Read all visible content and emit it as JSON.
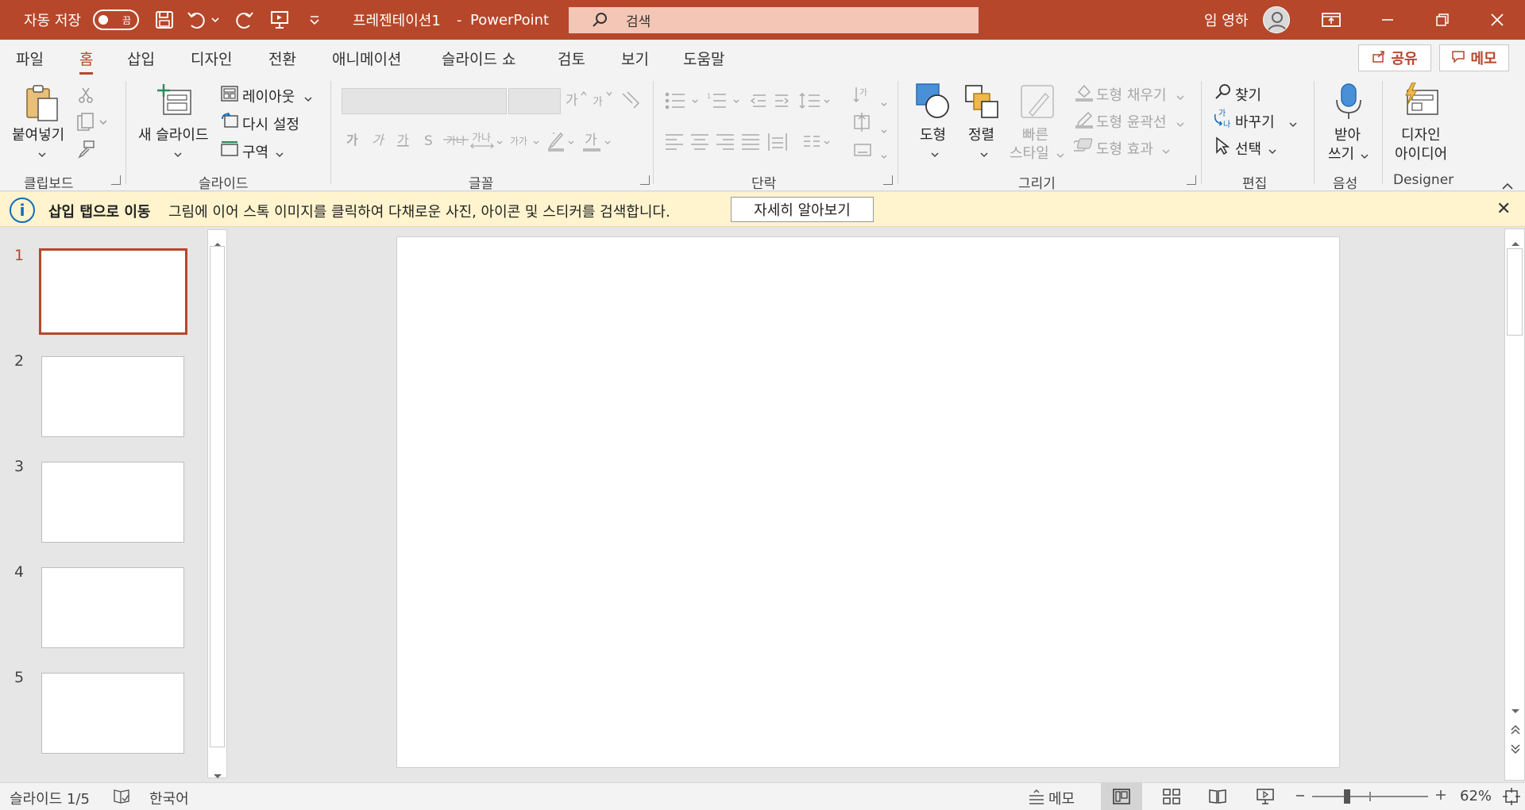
{
  "titlebar": {
    "autosave_label": "자동 저장",
    "autosave_state": "끔",
    "doc_title": "프레젠테이션1",
    "separator": "-",
    "app_name": "PowerPoint",
    "search_placeholder": "검색",
    "user_name": "임 영하"
  },
  "tabs": [
    "파일",
    "홈",
    "삽입",
    "디자인",
    "전환",
    "애니메이션",
    "슬라이드 쇼",
    "검토",
    "보기",
    "도움말"
  ],
  "active_tab": "홈",
  "share_label": "공유",
  "comments_label": "메모",
  "ribbon": {
    "clipboard": {
      "paste": "붙여넣기",
      "group": "클립보드"
    },
    "slides": {
      "new_slide": "새 슬라이드",
      "layout": "레이아웃",
      "reset": "다시 설정",
      "section": "구역",
      "group": "슬라이드"
    },
    "font": {
      "group": "글꼴"
    },
    "paragraph": {
      "group": "단락"
    },
    "drawing": {
      "shapes": "도형",
      "arrange": "정렬",
      "quick_styles_1": "빠른",
      "quick_styles_2": "스타일",
      "shape_fill": "도형 채우기",
      "shape_outline": "도형 윤곽선",
      "shape_effects": "도형 효과",
      "group": "그리기"
    },
    "editing": {
      "find": "찾기",
      "replace": "바꾸기",
      "select": "선택",
      "group": "편집"
    },
    "voice": {
      "dictate_1": "받아",
      "dictate_2": "쓰기",
      "group": "음성"
    },
    "designer": {
      "ideas_1": "디자인",
      "ideas_2": "아이디어",
      "group": "Designer"
    }
  },
  "infobar": {
    "title": "삽입 탭으로 이동",
    "message": "그림에 이어 스톡 이미지를 클릭하여 다채로운 사진, 아이콘 및 스티커를 검색합니다.",
    "button": "자세히 알아보기"
  },
  "slides": [
    {
      "number": "1",
      "selected": true
    },
    {
      "number": "2",
      "selected": false
    },
    {
      "number": "3",
      "selected": false
    },
    {
      "number": "4",
      "selected": false
    },
    {
      "number": "5",
      "selected": false
    }
  ],
  "statusbar": {
    "slide_counter": "슬라이드 1/5",
    "language": "한국어",
    "notes": "메모",
    "zoom_level": "62%"
  },
  "colors": {
    "accent": "#b7472a",
    "info_bg": "#fff4ce",
    "info_icon": "#0f6cbd"
  }
}
